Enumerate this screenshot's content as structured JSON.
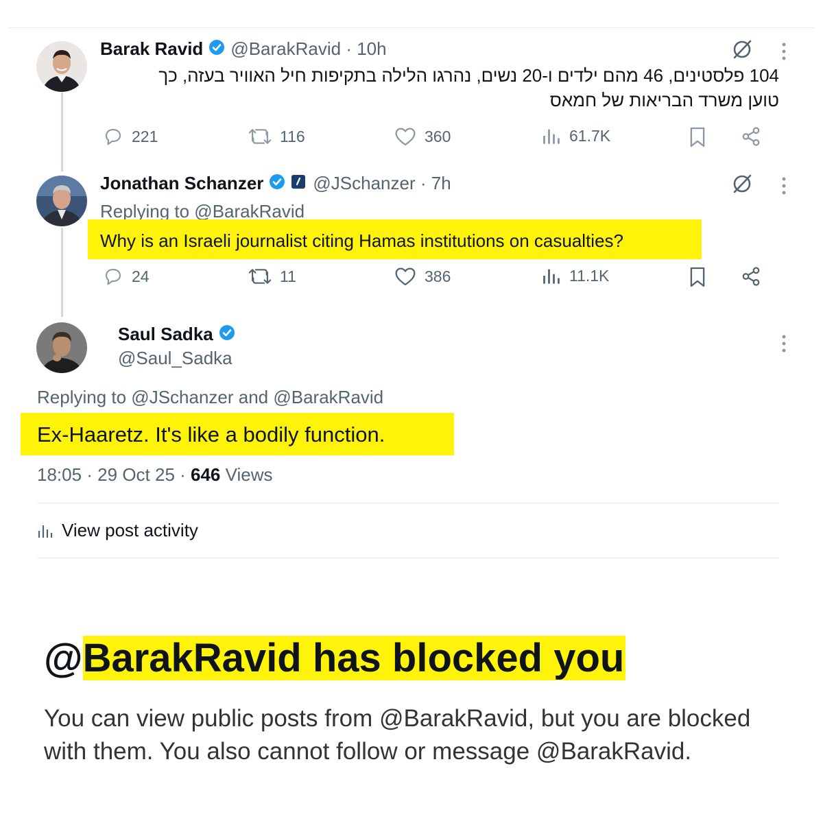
{
  "thread": [
    {
      "name": "Barak Ravid",
      "handle": "@BarakRavid",
      "time": "10h",
      "text_line1": "104 פלסטינים, 46 מהם ילדים ו-20 נשים, נהרגו הלילה בתקיפות חיל האוויר בעזה, כך",
      "text_line2": "טוען משרד הבריאות של חמאס",
      "replies": "221",
      "reposts": "116",
      "likes": "360",
      "views": "61.7K"
    },
    {
      "name": "Jonathan Schanzer",
      "handle": "@JSchanzer",
      "time": "7h",
      "replying_to": "Replying to @BarakRavid",
      "text": "Why is an Israeli journalist citing Hamas institutions on casualties?",
      "replies": "24",
      "reposts": "11",
      "likes": "386",
      "views": "11.1K"
    }
  ],
  "main_post": {
    "name": "Saul Sadka",
    "handle": "@Saul_Sadka",
    "replying_to": "Replying to @JSchanzer and @BarakRavid",
    "text": "Ex-Haaretz. It's like a bodily function.",
    "timestamp": "18:05 · 29 Oct 25 · ",
    "views_count": "646",
    "views_label": " Views",
    "activity_label": "View post activity"
  },
  "blocked": {
    "at": "@",
    "title": "BarakRavid has blocked you",
    "body_line1": "You can view public posts from @BarakRavid, but you are blocked",
    "body_line2": "with them. You also cannot follow or message @BarakRavid."
  },
  "colors": {
    "highlight": "#fff30a",
    "verified": "#1d9bf0",
    "secondary_text": "#536471"
  },
  "icons": [
    "reply-icon",
    "repost-icon",
    "like-icon",
    "views-icon",
    "bookmark-icon",
    "share-icon",
    "grok-icon",
    "more-icon",
    "verified-icon"
  ]
}
